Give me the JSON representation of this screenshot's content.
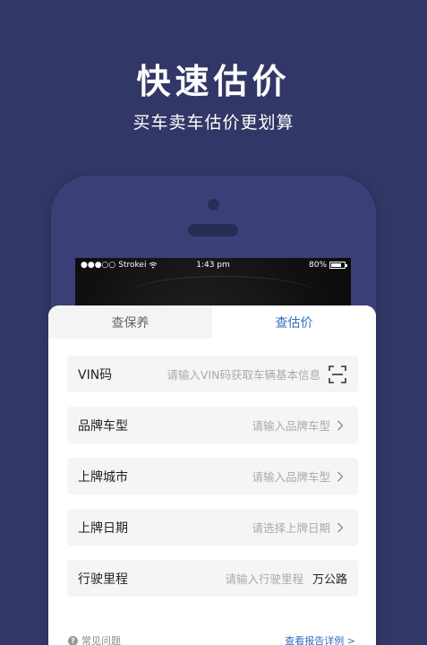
{
  "hero": {
    "title": "快速估价",
    "subtitle": "买车卖车估价更划算"
  },
  "status_bar": {
    "carrier": "Strokei",
    "time": "1:43 pm",
    "battery": "80%",
    "battery_level": 0.8
  },
  "tabs": [
    {
      "label": "查保养",
      "active": false
    },
    {
      "label": "查估价",
      "active": true
    }
  ],
  "form": {
    "vin": {
      "label": "VIN码",
      "placeholder": "请输入VIN码获取车辆基本信息"
    },
    "model": {
      "label": "品牌车型",
      "placeholder": "请输入品牌车型"
    },
    "city": {
      "label": "上牌城市",
      "placeholder": "请输入品牌车型"
    },
    "date": {
      "label": "上牌日期",
      "placeholder": "请选择上牌日期"
    },
    "mileage": {
      "label": "行驶里程",
      "placeholder": "请输入行驶里程",
      "unit": "万公路"
    }
  },
  "footer": {
    "faq": "常见问题",
    "report_link": "查看报告详例 >"
  },
  "colors": {
    "background": "#313766",
    "accent": "#2f6cc4"
  },
  "icons": {
    "scan": "scan-icon",
    "chevron": "chevron-right-icon",
    "faq": "question-circle-icon"
  }
}
